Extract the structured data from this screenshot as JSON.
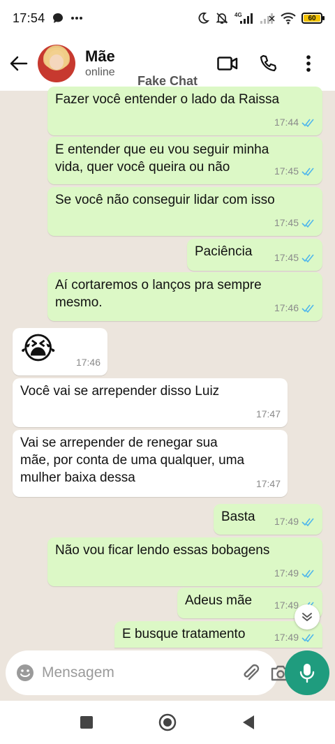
{
  "status_bar": {
    "time": "17:54",
    "icons": [
      "chat-bubble-icon",
      "more-dots-icon",
      "moon-icon",
      "bell-off-icon",
      "signal-4g-icon",
      "signal-icon",
      "wifi-icon"
    ],
    "network_label": "4G",
    "battery_level": "60"
  },
  "header": {
    "contact_name": "Mãe",
    "contact_status": "online",
    "watermark": "Fake Chat",
    "icons": [
      "back-arrow-icon",
      "video-call-icon",
      "phone-icon",
      "more-vert-icon"
    ]
  },
  "messages": [
    {
      "direction": "out",
      "text": "Fazer você entender o lado da Raissa",
      "time": "17:44",
      "read": true
    },
    {
      "direction": "out",
      "text": "E entender que eu vou seguir minha\nvida, quer você queira ou não",
      "time": "17:45",
      "read": true
    },
    {
      "direction": "out",
      "text": "Se você não conseguir lidar com isso",
      "time": "17:45",
      "read": true
    },
    {
      "direction": "out",
      "text": "Paciência",
      "time": "17:45",
      "read": true
    },
    {
      "direction": "out",
      "text": "Aí cortaremos o lanços pra sempre\nmesmo.",
      "time": "17:46",
      "read": true
    },
    {
      "direction": "in",
      "text": "😭",
      "time": "17:46"
    },
    {
      "direction": "in",
      "text": "Você vai se arrepender disso Luiz",
      "time": "17:47"
    },
    {
      "direction": "in",
      "text": "Vai se arrepender de renegar sua\nmãe, por conta de uma qualquer, uma\nmulher baixa dessa",
      "time": "17:47"
    },
    {
      "direction": "out",
      "text": "Basta",
      "time": "17:49",
      "read": true
    },
    {
      "direction": "out",
      "text": "Não vou ficar lendo essas bobagens",
      "time": "17:49",
      "read": true
    },
    {
      "direction": "out",
      "text": "Adeus mãe",
      "time": "17:49",
      "read": true
    },
    {
      "direction": "out",
      "text": "E busque tratamento",
      "time": "17:49",
      "read": true
    }
  ],
  "composer": {
    "placeholder": "Mensagem",
    "icons": [
      "emoji-icon",
      "attach-icon",
      "camera-icon",
      "mic-icon"
    ]
  },
  "nav": {
    "icons": [
      "recents-square-icon",
      "home-circle-icon",
      "back-triangle-icon"
    ]
  },
  "colors": {
    "outgoing_bubble": "#dcf8c6",
    "incoming_bubble": "#ffffff",
    "chat_background": "#ece5dd",
    "accent": "#1f9c7e",
    "read_ticks": "#4fb6ec"
  }
}
